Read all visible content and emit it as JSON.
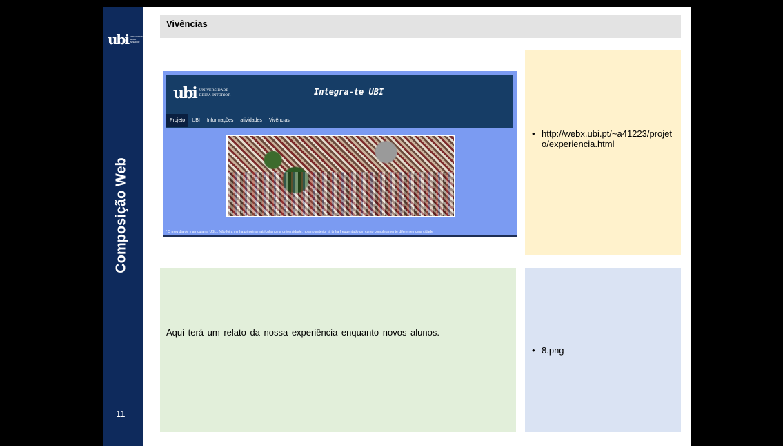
{
  "slide": {
    "title": "Vivências",
    "sidebar_title": "Composição Web",
    "page_number": "11",
    "logo_text": "ubi",
    "logo_tiny_lines": [
      "UNIVERSIDADE",
      "BEIRA INTERIOR"
    ]
  },
  "screenshot": {
    "logo_lines": [
      "UNIVERSIDADE",
      "BEIRA INTERIOR"
    ],
    "site_title": "Integra-te UBI",
    "nav": [
      "Projeto",
      "UBI",
      "Informações",
      "atividades",
      "Vivências"
    ],
    "active_nav": "Projeto",
    "caption": "\" O meu dia de matrícula na UBI... Não foi a minha primeira matrícula numa universidade, no ano anterior já tinha frequentado um curso completamente diferente numa cidade",
    "photo_icon": "crowd-photo-icon"
  },
  "content": {
    "url_bullet": "http://webx.ubi.pt/~a41223/projeto/experiencia.html",
    "relato_text": "Aqui terá um relato da nossa experiência enquanto novos alunos.",
    "image_bullet": "8.png",
    "bullet_char": "•"
  },
  "colors": {
    "sidebar": "#0e2a5c",
    "title_bar": "#e3e3e3",
    "yellow_box": "#fff2cc",
    "green_box": "#e2efda",
    "blue_box": "#dae3f3",
    "screenshot_bg": "#7b9bf2",
    "screenshot_header": "#163d66"
  }
}
